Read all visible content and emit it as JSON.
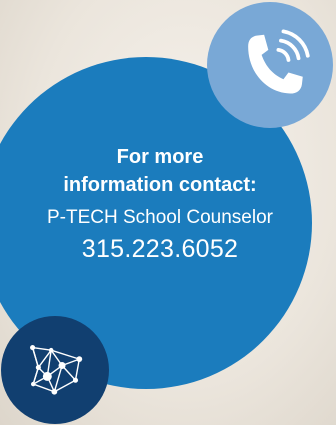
{
  "card": {
    "heading_line1": "For more",
    "heading_line2": "information contact:",
    "role": "P-TECH School Counselor",
    "phone": "315.223.6052"
  },
  "icons": {
    "phone": "phone-icon",
    "network": "network-icon"
  },
  "colors": {
    "main_circle": "#1b7cbd",
    "phone_badge": "#79a8d6",
    "network_badge": "#113f70",
    "text": "#ffffff",
    "background": "#efe9e1"
  }
}
